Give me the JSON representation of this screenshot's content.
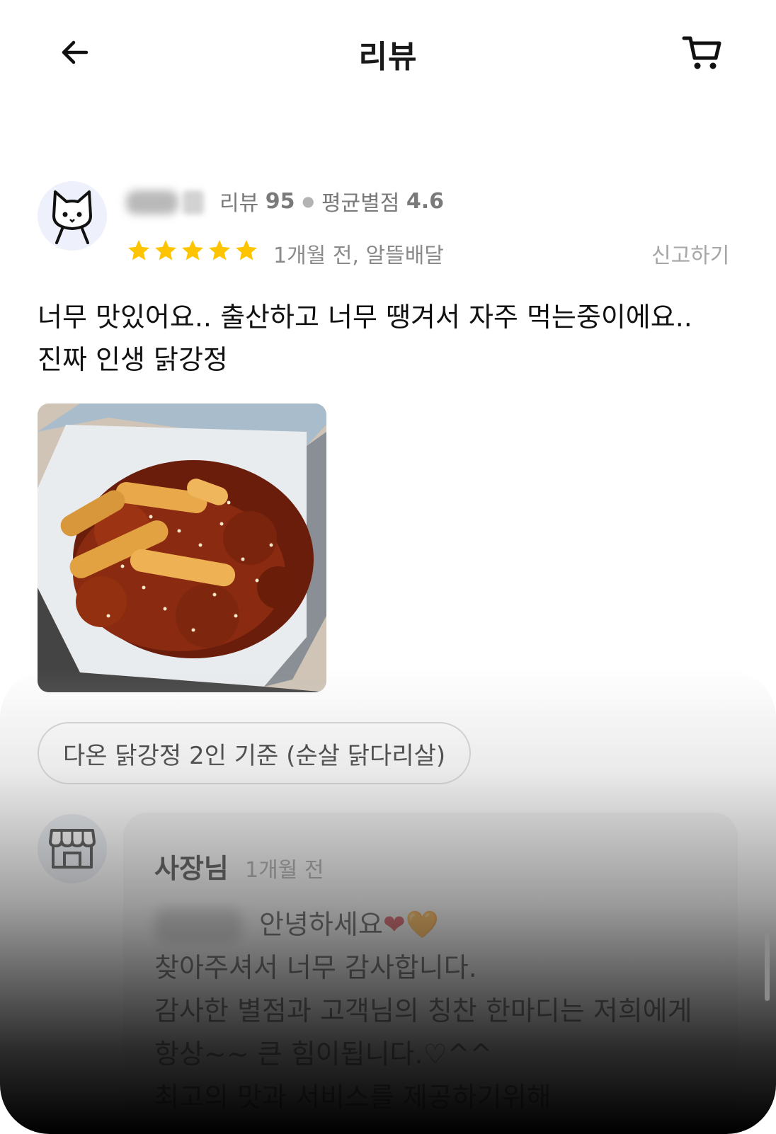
{
  "header": {
    "title": "리뷰",
    "back_icon": "arrow-left-icon",
    "cart_icon": "cart-icon"
  },
  "review": {
    "reviewer_avatar_icon": "cat-avatar-icon",
    "stats_review_label": "리뷰",
    "stats_review_count": "95",
    "stats_avg_label": "평균별점",
    "stats_avg_value": "4.6",
    "rating": 5,
    "meta": "1개월 전, 알뜰배달",
    "report_label": "신고하기",
    "text": "너무 맛있어요.. 출산하고 너무 땡겨서 자주 먹는중이에요.. 진짜 인생 닭강정",
    "menu_chip": "다온 닭강정 2인 기준 (순살 닭다리살)"
  },
  "owner_reply": {
    "avatar_icon": "store-icon",
    "name": "사장님",
    "time": "1개월 전",
    "greeting": "안녕하세요",
    "hearts": [
      "❤",
      "🧡"
    ],
    "lines": [
      "찾아주셔서 너무 감사합니다.",
      "감사한 별점과 고객님의 칭찬 한마디는 저희에게 항상~~ 큰 힘이됩니다.♡^^",
      "최고의 맛과 서비스를 제공하기위해"
    ]
  },
  "colors": {
    "star": "#FFC400",
    "avatar_bg": "#EEF0FB",
    "muted_text": "#8A8A8A"
  }
}
